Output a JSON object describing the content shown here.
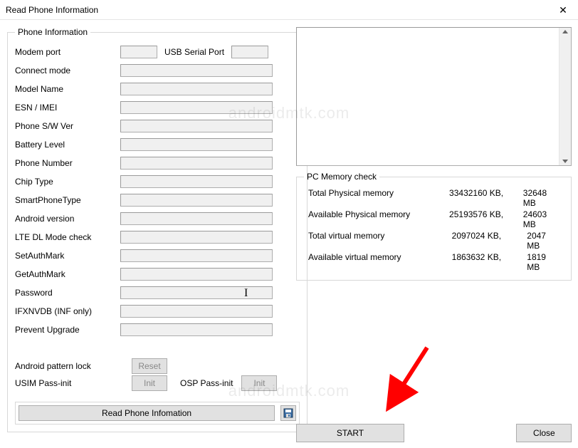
{
  "window": {
    "title": "Read Phone Information"
  },
  "groupbox": {
    "phone_info": "Phone Information",
    "pc_mem": "PC Memory check"
  },
  "labels": {
    "modem_port": "Modem port",
    "usb_serial": "USB Serial Port",
    "connect_mode": "Connect mode",
    "model_name": "Model Name",
    "esn_imei": "ESN / IMEI",
    "phone_sw_ver": "Phone S/W Ver",
    "battery_level": "Battery Level",
    "phone_number": "Phone Number",
    "chip_type": "Chip Type",
    "smartphone_type": "SmartPhoneType",
    "android_version": "Android version",
    "lte_dl": "LTE DL Mode check",
    "set_auth": "SetAuthMark",
    "get_auth": "GetAuthMark",
    "password": "Password",
    "ifxnvdb": "IFXNVDB (INF only)",
    "prevent_upgrade": "Prevent Upgrade",
    "android_pattern_lock": "Android pattern lock",
    "usim_pass_init": "USIM Pass-init",
    "osp_pass_init": "OSP Pass-init"
  },
  "buttons": {
    "reset": "Reset",
    "init": "Init",
    "read_phone": "Read Phone Infomation",
    "start": "START",
    "close": "Close"
  },
  "memory": [
    {
      "label": "Total Physical memory",
      "kb": "33432160 KB,",
      "mb": "32648 MB"
    },
    {
      "label": "Available Physical memory",
      "kb": "25193576 KB,",
      "mb": "24603 MB"
    },
    {
      "label": "Total virtual memory",
      "kb": "2097024 KB,",
      "mb": "2047 MB"
    },
    {
      "label": "Available virtual memory",
      "kb": "1863632 KB,",
      "mb": "1819 MB"
    }
  ],
  "watermark": "androidmtk.com"
}
